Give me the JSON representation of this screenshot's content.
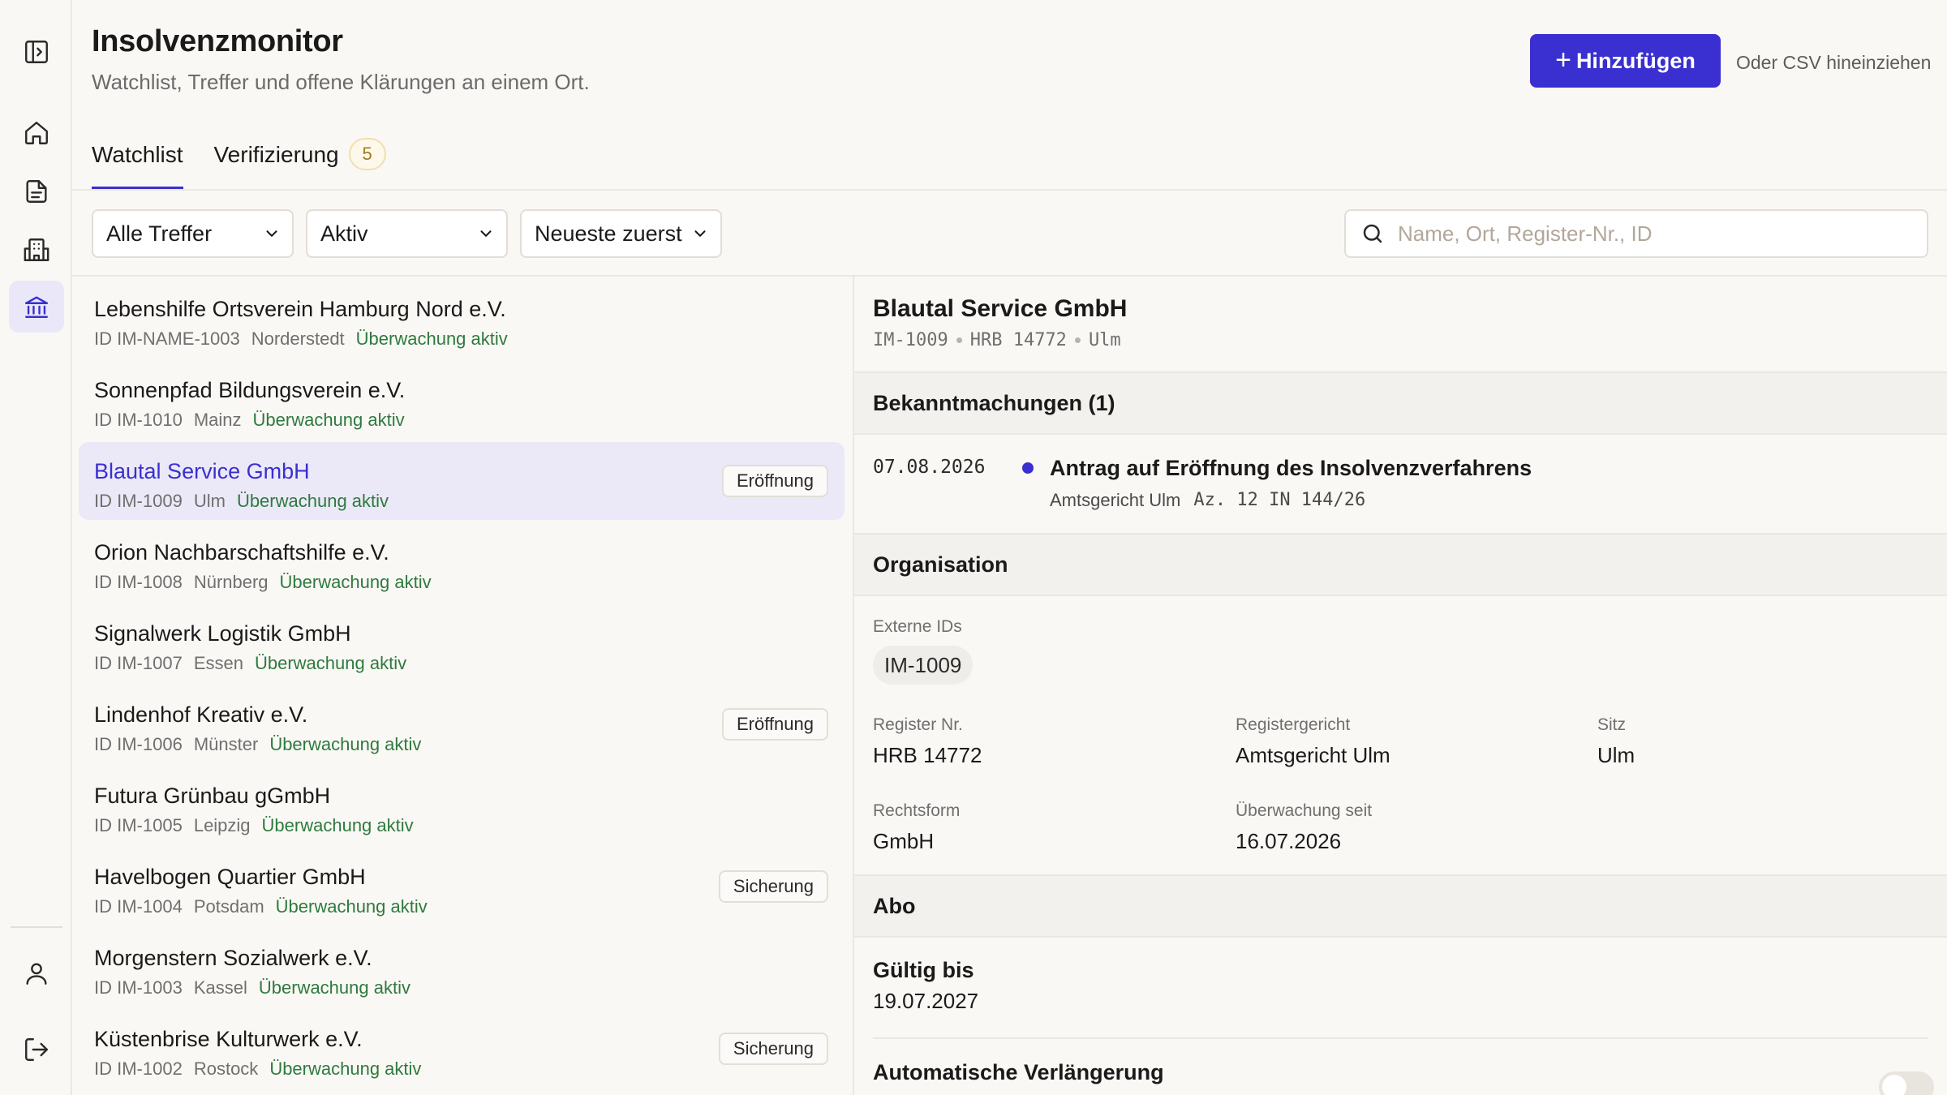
{
  "app": {
    "title": "Insolvenzmonitor",
    "subtitle": "Watchlist, Treffer und offene Klärungen an einem Ort.",
    "add_button": "Hinzufügen",
    "csv_hint": "Oder CSV hineinziehen"
  },
  "tabs": [
    {
      "label": "Watchlist",
      "active": true
    },
    {
      "label": "Verifizierung",
      "badge": "5",
      "active": false
    }
  ],
  "filters": {
    "match": "Alle Treffer",
    "status": "Aktiv",
    "sort": "Neueste zuerst",
    "search_placeholder": "Name, Ort, Register-Nr., ID"
  },
  "list": [
    {
      "name": "Lebenshilfe Ortsverein Hamburg Nord e.V.",
      "id": "ID IM-NAME-1003",
      "city": "Norderstedt",
      "status": "Überwachung aktiv",
      "tag": ""
    },
    {
      "name": "Sonnenpfad Bildungsverein e.V.",
      "id": "ID IM-1010",
      "city": "Mainz",
      "status": "Überwachung aktiv",
      "tag": ""
    },
    {
      "name": "Blautal Service GmbH",
      "id": "ID IM-1009",
      "city": "Ulm",
      "status": "Überwachung aktiv",
      "tag": "Eröffnung",
      "selected": true
    },
    {
      "name": "Orion Nachbarschaftshilfe e.V.",
      "id": "ID IM-1008",
      "city": "Nürnberg",
      "status": "Überwachung aktiv",
      "tag": ""
    },
    {
      "name": "Signalwerk Logistik GmbH",
      "id": "ID IM-1007",
      "city": "Essen",
      "status": "Überwachung aktiv",
      "tag": ""
    },
    {
      "name": "Lindenhof Kreativ e.V.",
      "id": "ID IM-1006",
      "city": "Münster",
      "status": "Überwachung aktiv",
      "tag": "Eröffnung"
    },
    {
      "name": "Futura Grünbau gGmbH",
      "id": "ID IM-1005",
      "city": "Leipzig",
      "status": "Überwachung aktiv",
      "tag": ""
    },
    {
      "name": "Havelbogen Quartier GmbH",
      "id": "ID IM-1004",
      "city": "Potsdam",
      "status": "Überwachung aktiv",
      "tag": "Sicherung"
    },
    {
      "name": "Morgenstern Sozialwerk e.V.",
      "id": "ID IM-1003",
      "city": "Kassel",
      "status": "Überwachung aktiv",
      "tag": ""
    },
    {
      "name": "Küstenbrise Kulturwerk e.V.",
      "id": "ID IM-1002",
      "city": "Rostock",
      "status": "Überwachung aktiv",
      "tag": "Sicherung"
    }
  ],
  "detail": {
    "name": "Blautal Service GmbH",
    "id": "IM-1009",
    "register": "HRB 14772",
    "city": "Ulm",
    "announcements_title": "Bekanntmachungen (1)",
    "announcement": {
      "date": "07.08.2026",
      "title": "Antrag auf Eröffnung des Insolvenzverfahrens",
      "court": "Amtsgericht Ulm",
      "file_no": "Az. 12 IN 144/26"
    },
    "organisation_title": "Organisation",
    "external_ids_label": "Externe IDs",
    "external_id": "IM-1009",
    "register_nr_label": "Register Nr.",
    "register_nr": "HRB 14772",
    "register_court_label": "Registergericht",
    "register_court": "Amtsgericht Ulm",
    "seat_label": "Sitz",
    "seat": "Ulm",
    "legal_form_label": "Rechtsform",
    "legal_form": "GmbH",
    "monitored_since_label": "Überwachung seit",
    "monitored_since": "16.07.2026",
    "abo_title": "Abo",
    "valid_until_label": "Gültig bis",
    "valid_until": "19.07.2027",
    "auto_renew_label": "Automatische Verlängerung",
    "auto_renew": false
  },
  "colors": {
    "accent": "#3a2fd0",
    "status_green": "#2e7a3e",
    "badge_amber": "#a07a20"
  },
  "icons": [
    "sidebar-toggle-icon",
    "home-icon",
    "document-icon",
    "building-icon",
    "bank-icon",
    "user-icon",
    "logout-icon",
    "chevron-down-icon",
    "search-icon",
    "plus-icon"
  ]
}
